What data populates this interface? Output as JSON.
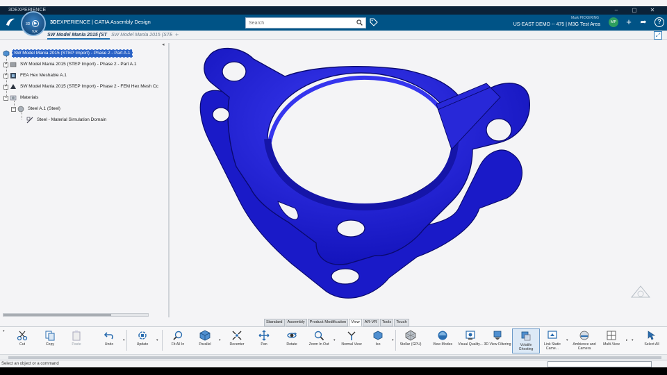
{
  "os_window": {
    "title": "3DEXPERIENCE",
    "controls": [
      "–",
      "▢",
      "✕"
    ]
  },
  "header": {
    "brand_logo": "3DS",
    "compass_num": "3D",
    "compass_label": "V,R",
    "app_prefix": "3D",
    "app_title": "EXPERIENCE | CATIA Assembly Design",
    "search_placeholder": "Search",
    "user_name": "Mark PICKERING",
    "tenant": "US-EAST DEMO -- 475 | M3G Test Area",
    "avatar_initials": "MP",
    "add_icon": "+",
    "share_icon": "➦",
    "help_icon": "?"
  },
  "tabs": {
    "active": "SW Model Mania 2015 (ST",
    "inactive": "SW Model Mania 2015 (STE",
    "add": "+"
  },
  "tree": {
    "items": [
      {
        "label": "SW Model Mania 2015 (STEP Import) - Phase 2 - Part A.1",
        "selected": true
      },
      {
        "label": "SW Model Mania 2015 (STEP Import) - Phase 2 - Part A.1"
      },
      {
        "label": "FEA Hex Meshable A.1"
      },
      {
        "label": "SW Model Mania 2015 (STEP Import) - Phase 2 - FEM Hex Mesh Cc"
      },
      {
        "label": "Materials"
      },
      {
        "label": "Steel A.1 (Steel)"
      },
      {
        "label": "Steel - Material Simulation Domain"
      }
    ],
    "expander": "+"
  },
  "model": {
    "color": "#2323e0"
  },
  "section_tabs": [
    "Standard",
    "Assembly",
    "Product Modification",
    "View",
    "AR-VR",
    "Tools",
    "Touch"
  ],
  "section_tab_active": "View",
  "actions": [
    {
      "label": "Cut"
    },
    {
      "label": "Copy"
    },
    {
      "label": "Paste"
    },
    {
      "label": "Undo"
    },
    {
      "label": "Update"
    },
    {
      "label": "Fit All In"
    },
    {
      "label": "Parallel"
    },
    {
      "label": "Recenter"
    },
    {
      "label": "Pan"
    },
    {
      "label": "Rotate"
    },
    {
      "label": "Zoom In Out"
    },
    {
      "label": "Normal View"
    },
    {
      "label": "Iso"
    },
    {
      "label": "Stellar (GPU)"
    },
    {
      "label": "View Modes"
    },
    {
      "label": "Visual Quality..."
    },
    {
      "label": "3D View Filtering"
    },
    {
      "label": "Volatile Ghosting"
    },
    {
      "label": "Link Static Came..."
    },
    {
      "label": "Ambience and Camera"
    },
    {
      "label": "Multi-View"
    },
    {
      "label": "Select All"
    }
  ],
  "status": {
    "text": "Select an object or a command"
  }
}
